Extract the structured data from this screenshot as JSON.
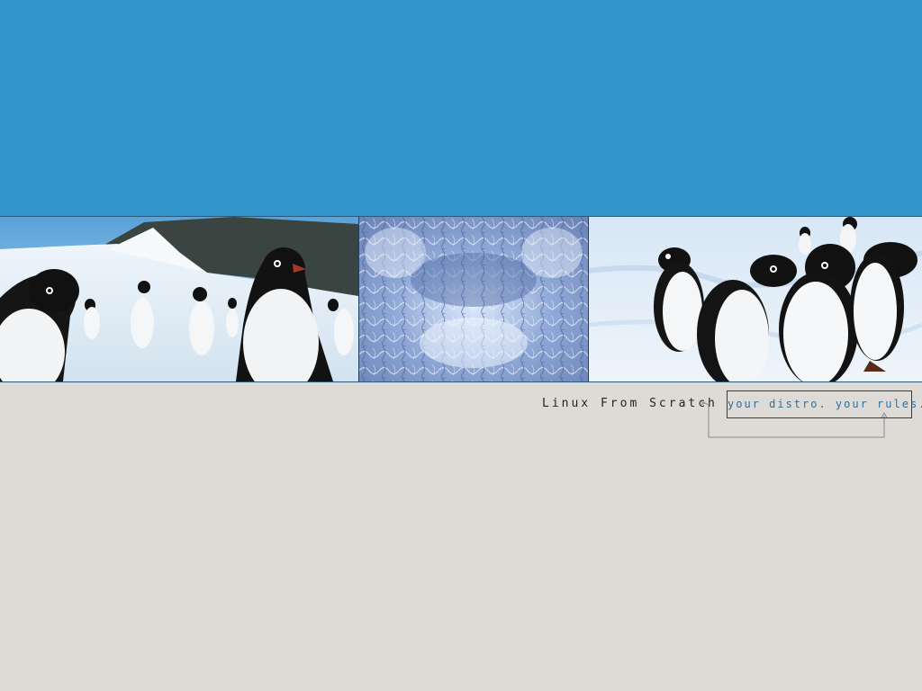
{
  "desktop": {
    "brand_text": "Linux From Scratch",
    "tagline": "your distro. your rules.",
    "colors": {
      "sky": "#3397cc",
      "background": "#dedbd6",
      "tagline_text": "#2f6f9a",
      "brand_text": "#222222"
    },
    "banner": {
      "panels": [
        {
          "name": "penguins-colony-photo",
          "icon": "penguin-photo"
        },
        {
          "name": "ice-texture",
          "icon": "ice-texture"
        },
        {
          "name": "penguins-group-photo",
          "icon": "penguin-photo"
        }
      ]
    }
  }
}
